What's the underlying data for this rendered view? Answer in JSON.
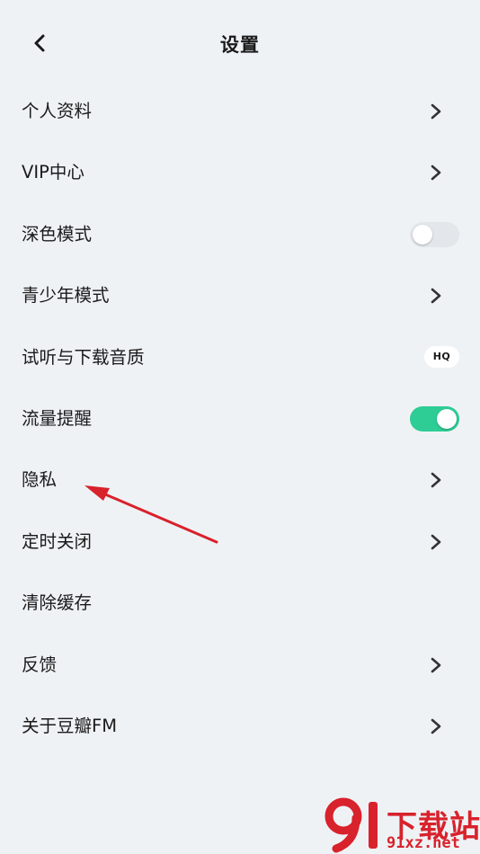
{
  "header": {
    "title": "设置",
    "back_icon": "chevron-left-icon"
  },
  "settings": [
    {
      "id": "profile",
      "label": "个人资料",
      "control": "chevron"
    },
    {
      "id": "vip",
      "label": "VIP中心",
      "control": "chevron"
    },
    {
      "id": "dark-mode",
      "label": "深色模式",
      "control": "toggle",
      "toggle_on": false
    },
    {
      "id": "youth-mode",
      "label": "青少年模式",
      "control": "chevron"
    },
    {
      "id": "audio-quality",
      "label": "试听与下载音质",
      "control": "badge",
      "badge": "HQ"
    },
    {
      "id": "data-alert",
      "label": "流量提醒",
      "control": "toggle",
      "toggle_on": true
    },
    {
      "id": "privacy",
      "label": "隐私",
      "control": "chevron"
    },
    {
      "id": "sleep-timer",
      "label": "定时关闭",
      "control": "chevron"
    },
    {
      "id": "clear-cache",
      "label": "清除缓存",
      "control": "none"
    },
    {
      "id": "feedback",
      "label": "反馈",
      "control": "chevron"
    },
    {
      "id": "about",
      "label": "关于豆瓣FM",
      "control": "chevron"
    }
  ],
  "colors": {
    "background": "#eff2f5",
    "toggle_on": "#2dcd95",
    "toggle_off": "#e3e6ea",
    "annotation_arrow": "#d8222c"
  },
  "watermark": {
    "top_text": "下载站",
    "bottom_text": "91xz.net"
  }
}
